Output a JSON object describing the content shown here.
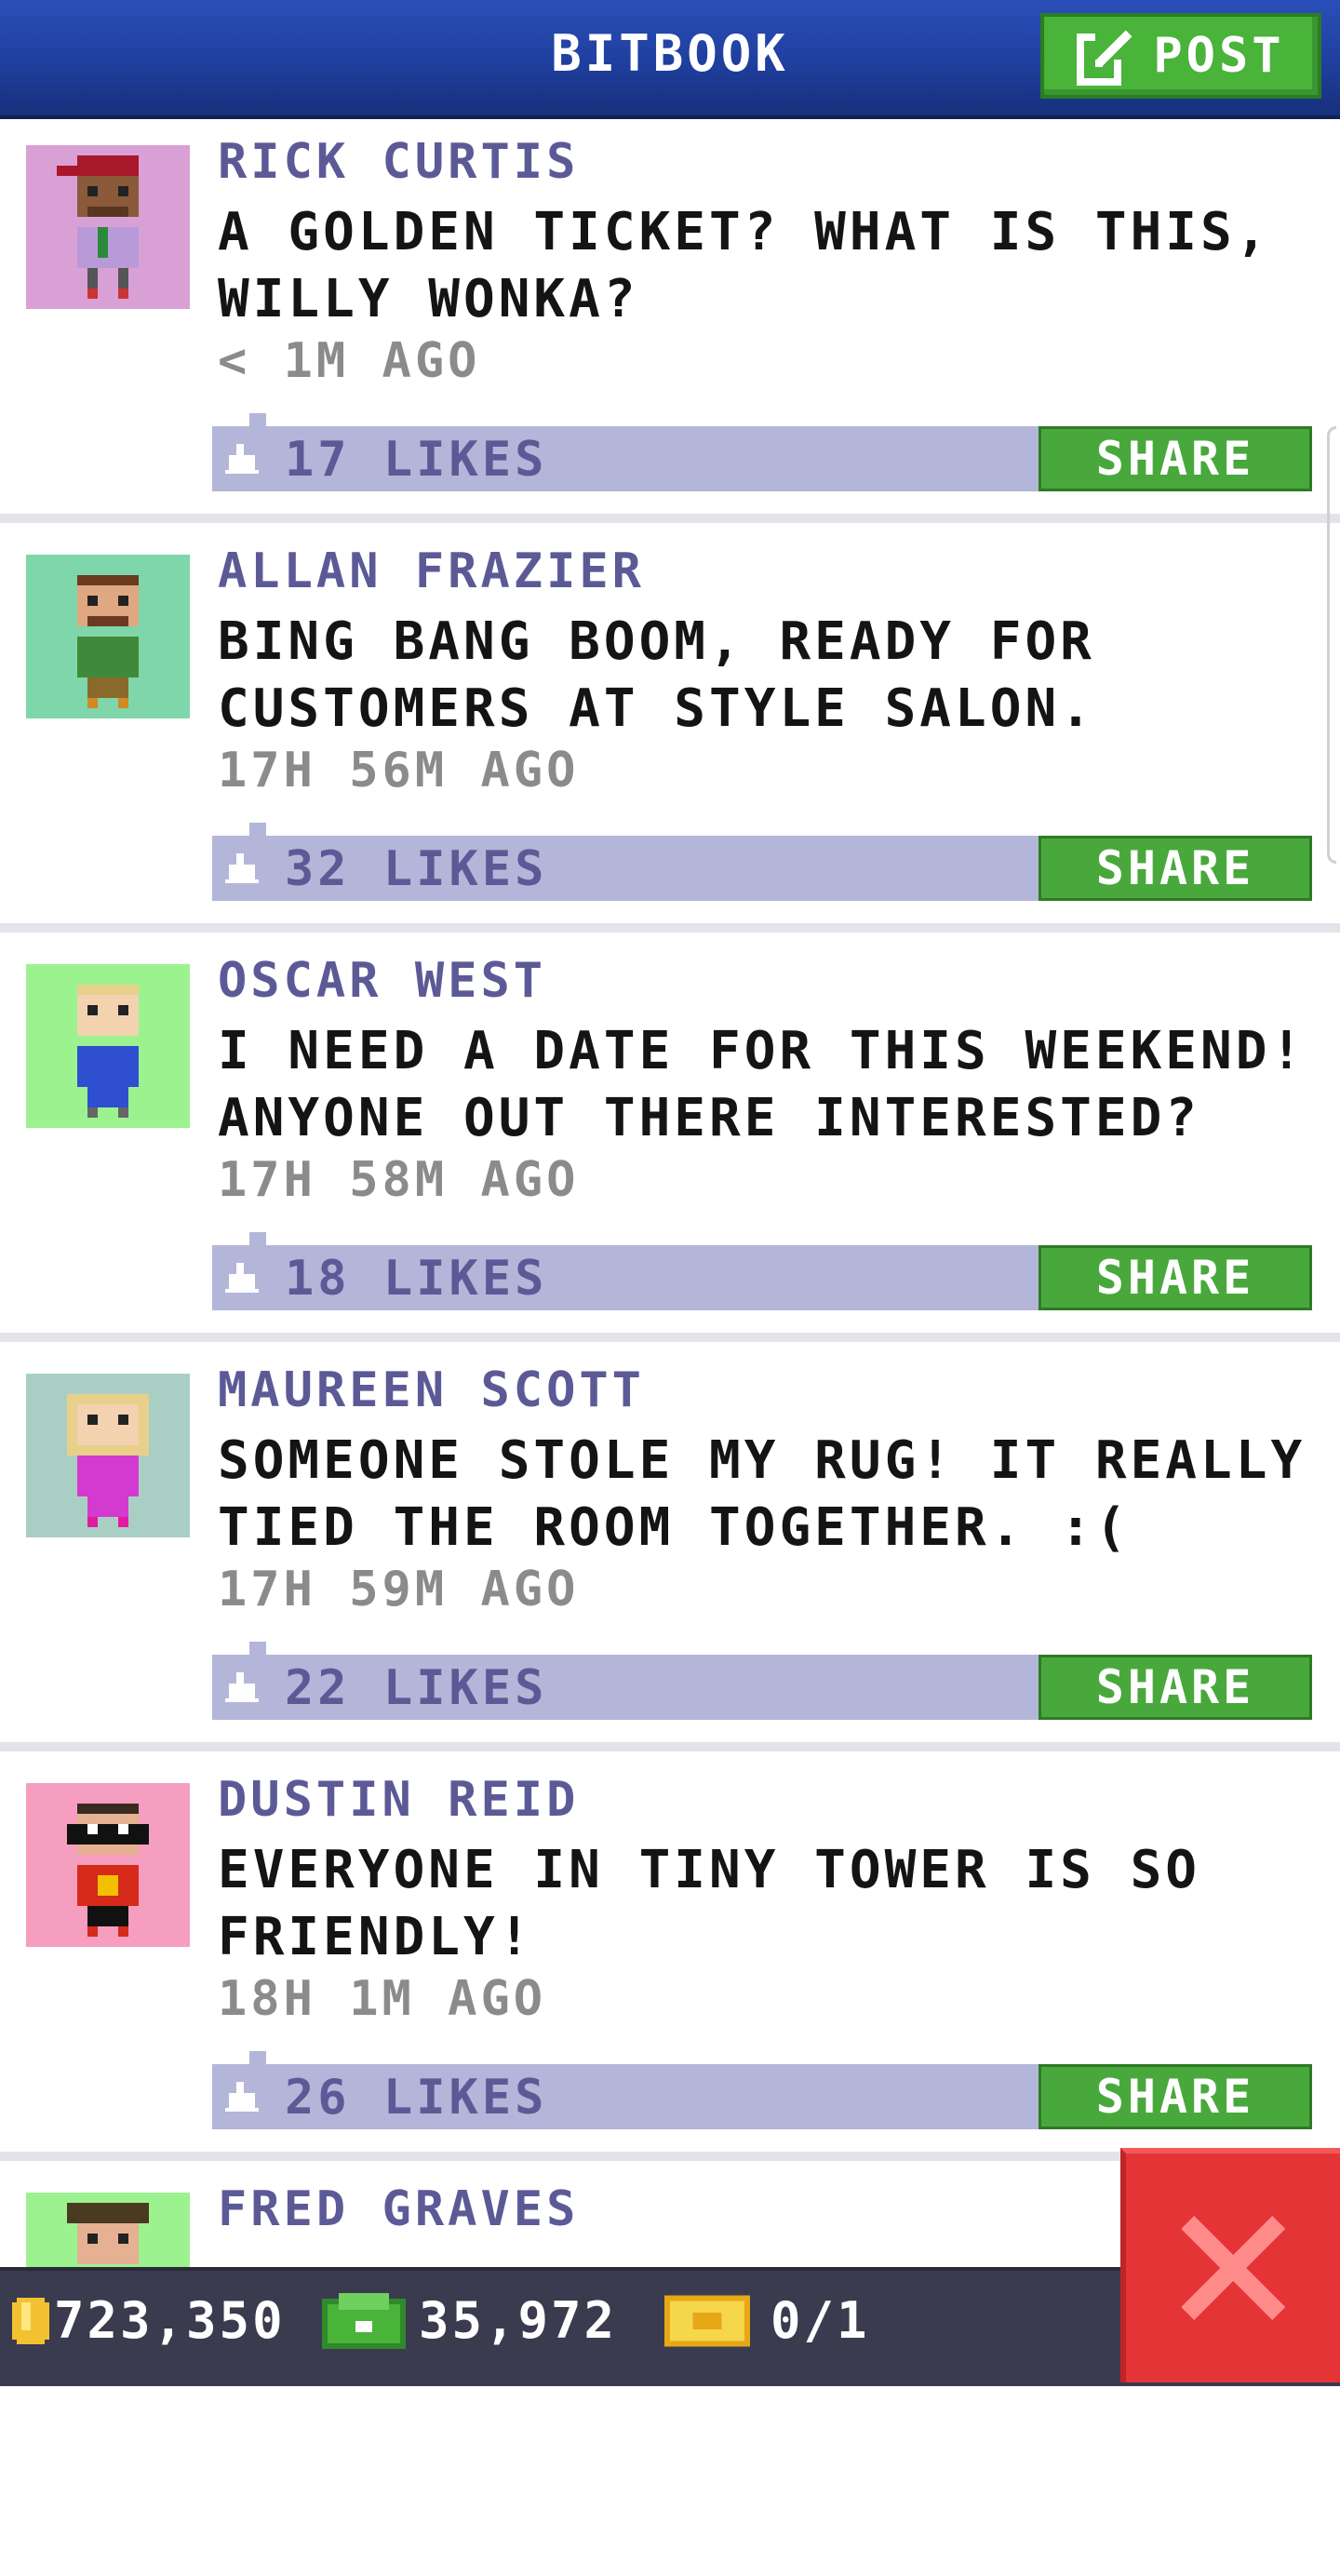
{
  "header": {
    "title": "BITBOOK",
    "post_label": "POST"
  },
  "posts": [
    {
      "name": "RICK CURTIS",
      "message": "A GOLDEN TICKET? WHAT IS THIS, WILLY WONKA?",
      "time": "< 1M AGO",
      "likes": "17 LIKES",
      "share_label": "SHARE",
      "avatar_bg": "#d9a0d6"
    },
    {
      "name": "ALLAN FRAZIER",
      "message": "BING BANG BOOM, READY FOR CUSTOMERS AT STYLE SALON.",
      "time": "17H 56M AGO",
      "likes": "32 LIKES",
      "share_label": "SHARE",
      "avatar_bg": "#7fd6aa"
    },
    {
      "name": "OSCAR WEST",
      "message": "I NEED A DATE FOR THIS WEEKEND! ANYONE OUT THERE INTERESTED?",
      "time": "17H 58M AGO",
      "likes": "18 LIKES",
      "share_label": "SHARE",
      "avatar_bg": "#9cf28f"
    },
    {
      "name": "MAUREEN SCOTT",
      "message": "SOMEONE STOLE MY RUG! IT REALLY TIED THE ROOM TOGETHER. :(",
      "time": "17H 59M AGO",
      "likes": "22 LIKES",
      "share_label": "SHARE",
      "avatar_bg": "#a9cfc4"
    },
    {
      "name": "DUSTIN REID",
      "message": "EVERYONE IN TINY TOWER IS SO FRIENDLY!",
      "time": "18H 1M AGO",
      "likes": "26 LIKES",
      "share_label": "SHARE",
      "avatar_bg": "#f59ec0"
    },
    {
      "name": "FRED GRAVES",
      "avatar_bg": "#9cf28f"
    }
  ],
  "footer": {
    "coins": "723,350",
    "bux": "35,972",
    "tickets": "0/1"
  },
  "icons": {
    "post": "edit-icon",
    "like": "thumbs-up-icon",
    "coin": "coin-icon",
    "bux": "bux-icon",
    "ticket": "golden-ticket-icon",
    "close": "close-icon"
  },
  "colors": {
    "header": "#1f3f9e",
    "share": "#49a83c",
    "likes_bar": "#b3b6d8",
    "close": "#e53436"
  }
}
